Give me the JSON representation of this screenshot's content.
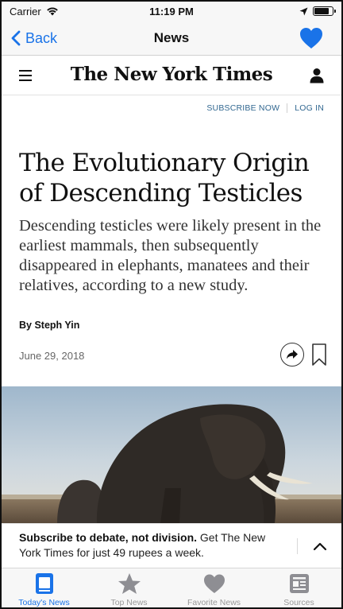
{
  "status_bar": {
    "carrier": "Carrier",
    "time": "11:19 PM",
    "battery_level": 0.8
  },
  "nav": {
    "back_label": "Back",
    "title": "News",
    "heart_icon": "heart-icon",
    "accent_color": "#1a73e8"
  },
  "nyt": {
    "logo_text": "The New York Times",
    "menu_icon": "hamburger-icon",
    "account_icon": "user-icon",
    "subscribe_label": "SUBSCRIBE NOW",
    "login_label": "LOG IN"
  },
  "article": {
    "headline": "The Evolutionary Origin of Descending Testicles",
    "summary": "Descending testicles were likely present in the earliest mammals, then subsequently disappeared in elephants, manatees and their relatives, according to a new study.",
    "byline": "By Steph Yin",
    "date": "June 29, 2018",
    "share_icon": "share-icon",
    "bookmark_icon": "bookmark-icon",
    "image_alt": "elephants on savanna"
  },
  "banner": {
    "bold": "Subscribe to debate, not division.",
    "rest": " Get The New York Times for just 49 rupees a week.",
    "caret_icon": "chevron-up-icon"
  },
  "tabs": [
    {
      "label": "Today's News",
      "icon": "newspaper-icon",
      "active": true
    },
    {
      "label": "Top News",
      "icon": "star-icon",
      "active": false
    },
    {
      "label": "Favorite News",
      "icon": "heart-icon",
      "active": false
    },
    {
      "label": "Sources",
      "icon": "document-icon",
      "active": false
    }
  ]
}
